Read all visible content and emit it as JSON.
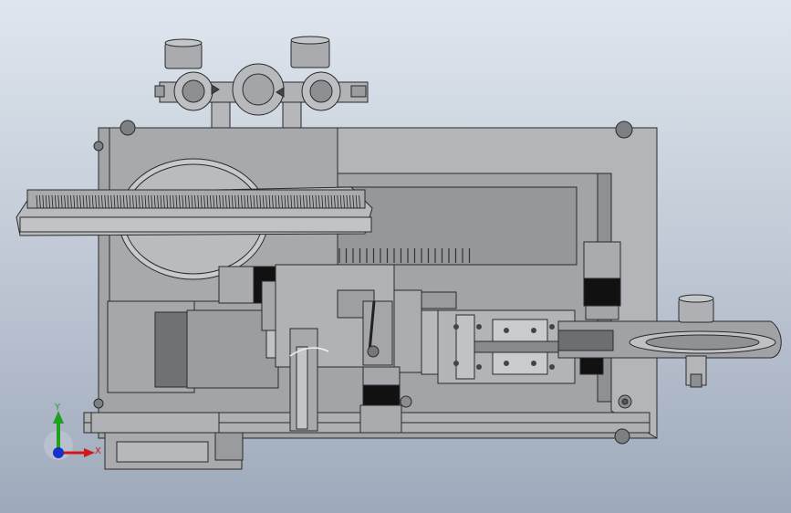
{
  "viewport": {
    "background_top": "#dfe6ee",
    "background_bottom": "#9ea9bb",
    "model_shade": "#9a9c9f",
    "model_edge": "#2a2a2a",
    "motor_black": "#111111"
  },
  "triad": {
    "y_label": "Y",
    "x_label": "X",
    "y_color": "#1fa01f",
    "x_color": "#d01818",
    "z_color": "#1830c8"
  }
}
